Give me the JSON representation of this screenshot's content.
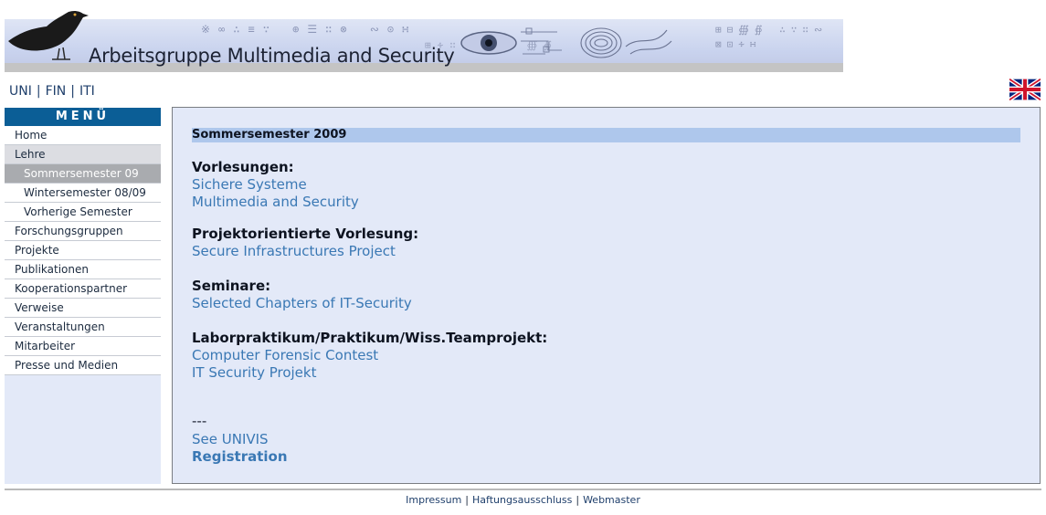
{
  "header": {
    "title": "Arbeitsgruppe Multimedia and Security"
  },
  "toplinks": {
    "uni": "UNI",
    "fin": "FIN",
    "iti": "ITI",
    "sep": "|"
  },
  "sidebar": {
    "heading": "MENÜ",
    "items": [
      {
        "label": "Home"
      },
      {
        "label": "Lehre"
      },
      {
        "label": "Sommersemester 09"
      },
      {
        "label": "Wintersemester 08/09"
      },
      {
        "label": "Vorherige Semester"
      },
      {
        "label": "Forschungsgruppen"
      },
      {
        "label": "Projekte"
      },
      {
        "label": "Publikationen"
      },
      {
        "label": "Kooperationspartner"
      },
      {
        "label": "Verweise"
      },
      {
        "label": "Veranstaltungen"
      },
      {
        "label": "Mitarbeiter"
      },
      {
        "label": "Presse und Medien"
      }
    ]
  },
  "main": {
    "semester": "Sommersemester 2009",
    "sections": [
      {
        "heading": "Vorlesungen:",
        "links": [
          "Sichere Systeme",
          "Multimedia and Security"
        ]
      },
      {
        "heading": "Projektorientierte Vorlesung:",
        "links": [
          "Secure Infrastructures Project"
        ]
      },
      {
        "heading": "Seminare:",
        "links": [
          "Selected Chapters of IT-Security"
        ]
      },
      {
        "heading": "Laborpraktikum/Praktikum/Wiss.Teamprojekt:",
        "links": [
          "Computer Forensic Contest",
          "IT Security Projekt"
        ]
      }
    ],
    "separator": "---",
    "univis": "See UNIVIS",
    "registration": "Registration"
  },
  "footer": {
    "impressum": "Impressum",
    "haftung": "Haftungsausschluss",
    "webmaster": "Webmaster",
    "sep": "|"
  },
  "colors": {
    "menu_header": "#0b5e96",
    "link": "#3a78b4",
    "content_bg": "#e3e9f8",
    "semester_bar": "#aec7ec",
    "active_item": "#a9abaf"
  },
  "icons": {
    "bird": "blackbird-logo-icon",
    "flag": "uk-flag-icon"
  }
}
